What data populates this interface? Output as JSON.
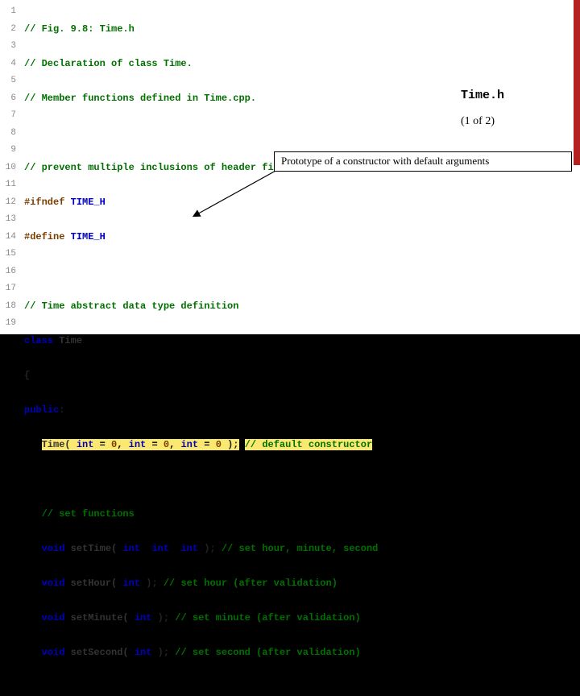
{
  "file": {
    "name": "Time.h",
    "pager": "(1 of 2)"
  },
  "callout": {
    "text": "Prototype of a constructor with default arguments"
  },
  "gutter": [
    "1",
    "2",
    "3",
    "4",
    "5",
    "6",
    "7",
    "8",
    "9",
    "10",
    "11",
    "12",
    "13",
    "14",
    "15",
    "16",
    "17",
    "18",
    "19"
  ],
  "code": {
    "l1": {
      "c": "// Fig. 9.8: Time.h"
    },
    "l2": {
      "c": "// Declaration of class Time."
    },
    "l3": {
      "c": "// Member functions defined in Time.cpp."
    },
    "l4": {
      "blank": " "
    },
    "l5": {
      "c": "// prevent multiple inclusions of header file"
    },
    "l6": {
      "m": "#ifndef",
      "id": " TIME_H"
    },
    "l7": {
      "m": "#define",
      "id": " TIME_H"
    },
    "l8": {
      "blank": " "
    },
    "l9": {
      "c": "// Time abstract data type definition"
    },
    "l10": {
      "k": "class",
      "sp": " ",
      "id": "Time"
    },
    "l11": {
      "p": "{"
    },
    "l12": {
      "k": "public",
      "p": ":"
    },
    "l13": {
      "indent": "   ",
      "id1": "Time( ",
      "k1": "int",
      "eq1": " = ",
      "n1": "0",
      "mid1": ", ",
      "k2": "int",
      "eq2": " = ",
      "n2": "0",
      "mid2": ", ",
      "k3": "int",
      "eq3": " = ",
      "n3": "0",
      "end": " );",
      "sp": " ",
      "c": "// default constructor"
    },
    "l14": {
      "blank": " "
    },
    "l15": {
      "indent": "   ",
      "c": "// set functions"
    },
    "l16": {
      "indent": "   ",
      "k0": "void",
      "sp0": " ",
      "id": "setTime( ",
      "k1": "int",
      "mid1": ", ",
      "k2": "int",
      "mid2": ", ",
      "k3": "int",
      "end": " );",
      "sp": " ",
      "c": "// set hour, minute, second"
    },
    "l17": {
      "indent": "   ",
      "k0": "void",
      "sp0": " ",
      "id": "setHour( ",
      "k1": "int",
      "end": " );",
      "sp": " ",
      "c": "// set hour (after validation)"
    },
    "l18": {
      "indent": "   ",
      "k0": "void",
      "sp0": " ",
      "id": "setMinute( ",
      "k1": "int",
      "end": " );",
      "sp": " ",
      "c": "// set minute (after validation)"
    },
    "l19": {
      "indent": "   ",
      "k0": "void",
      "sp0": " ",
      "id": "setSecond( ",
      "k1": "int",
      "end": " );",
      "sp": " ",
      "c": "// set second (after validation)"
    }
  }
}
